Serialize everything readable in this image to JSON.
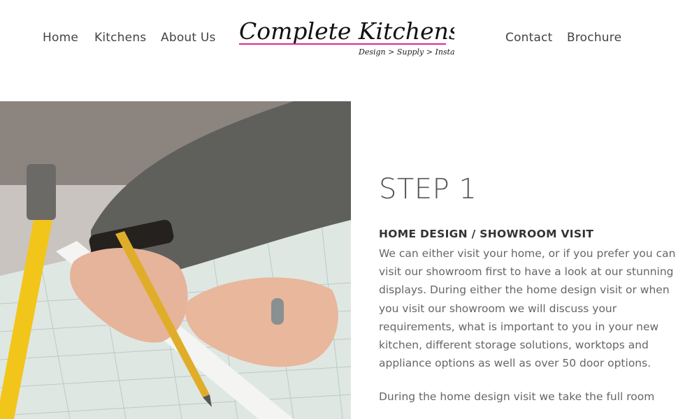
{
  "nav": {
    "left": [
      {
        "label": "Home"
      },
      {
        "label": "Kitchens"
      },
      {
        "label": "About Us"
      }
    ],
    "right": [
      {
        "label": "Contact"
      },
      {
        "label": "Brochure"
      }
    ]
  },
  "logo": {
    "title": "Complete Kitchens Ely",
    "tagline": "Design > Supply > Install",
    "accent_color": "#e0288f"
  },
  "photo": {
    "icon": "kitchen-design-photo"
  },
  "step": {
    "title": "STEP 1",
    "heading": "HOME DESIGN / SHOWROOM VISIT",
    "paragraph1": "We can either visit your home, or if you prefer you can visit our showroom first to have a look at our stunning displays. During either the home design visit or when you visit our showroom we will discuss your requirements, what is important to you in your new kitchen, different storage solutions, worktops and appliance options as well as over 50 door options.",
    "paragraph2": "During the home design visit we take the full room"
  }
}
